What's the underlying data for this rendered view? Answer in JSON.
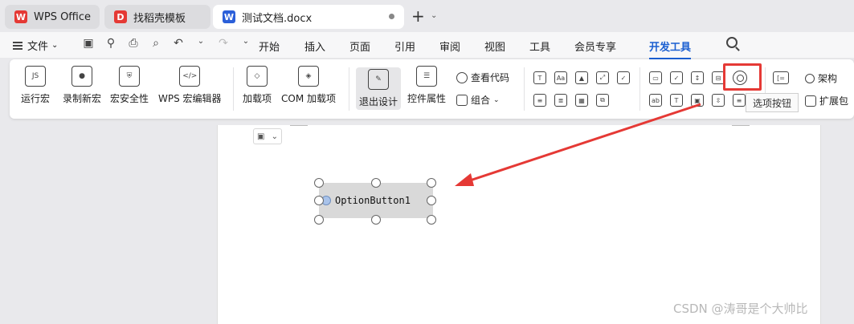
{
  "tabs": [
    {
      "label": "WPS Office",
      "icon": "wps-logo-icon"
    },
    {
      "label": "找稻壳模板",
      "icon": "docer-logo-icon"
    },
    {
      "label": "测试文档.docx",
      "icon": "word-doc-icon"
    }
  ],
  "menu": {
    "file_label": "文件",
    "tabs": [
      "开始",
      "插入",
      "页面",
      "引用",
      "审阅",
      "视图",
      "工具",
      "会员专享",
      "开发工具"
    ],
    "active_tab": "开发工具"
  },
  "ribbon": {
    "macro_buttons": [
      "运行宏",
      "录制新宏",
      "宏安全性",
      "WPS 宏编辑器"
    ],
    "addin_buttons": [
      "加载项",
      "COM 加载项"
    ],
    "design_buttons": [
      "退出设计",
      "控件属性"
    ],
    "view_code_label": "查看代码",
    "group_label": "组合",
    "structure_label": "架构",
    "extension_pack_label": "扩展包",
    "tooltip": "选项按钮"
  },
  "document": {
    "control_label": "OptionButton1"
  },
  "watermark": "CSDN @涛哥是个大帅比",
  "colors": {
    "accent": "#1b5fd1",
    "highlight": "#e53935",
    "control_bg": "#d9d9d9"
  }
}
